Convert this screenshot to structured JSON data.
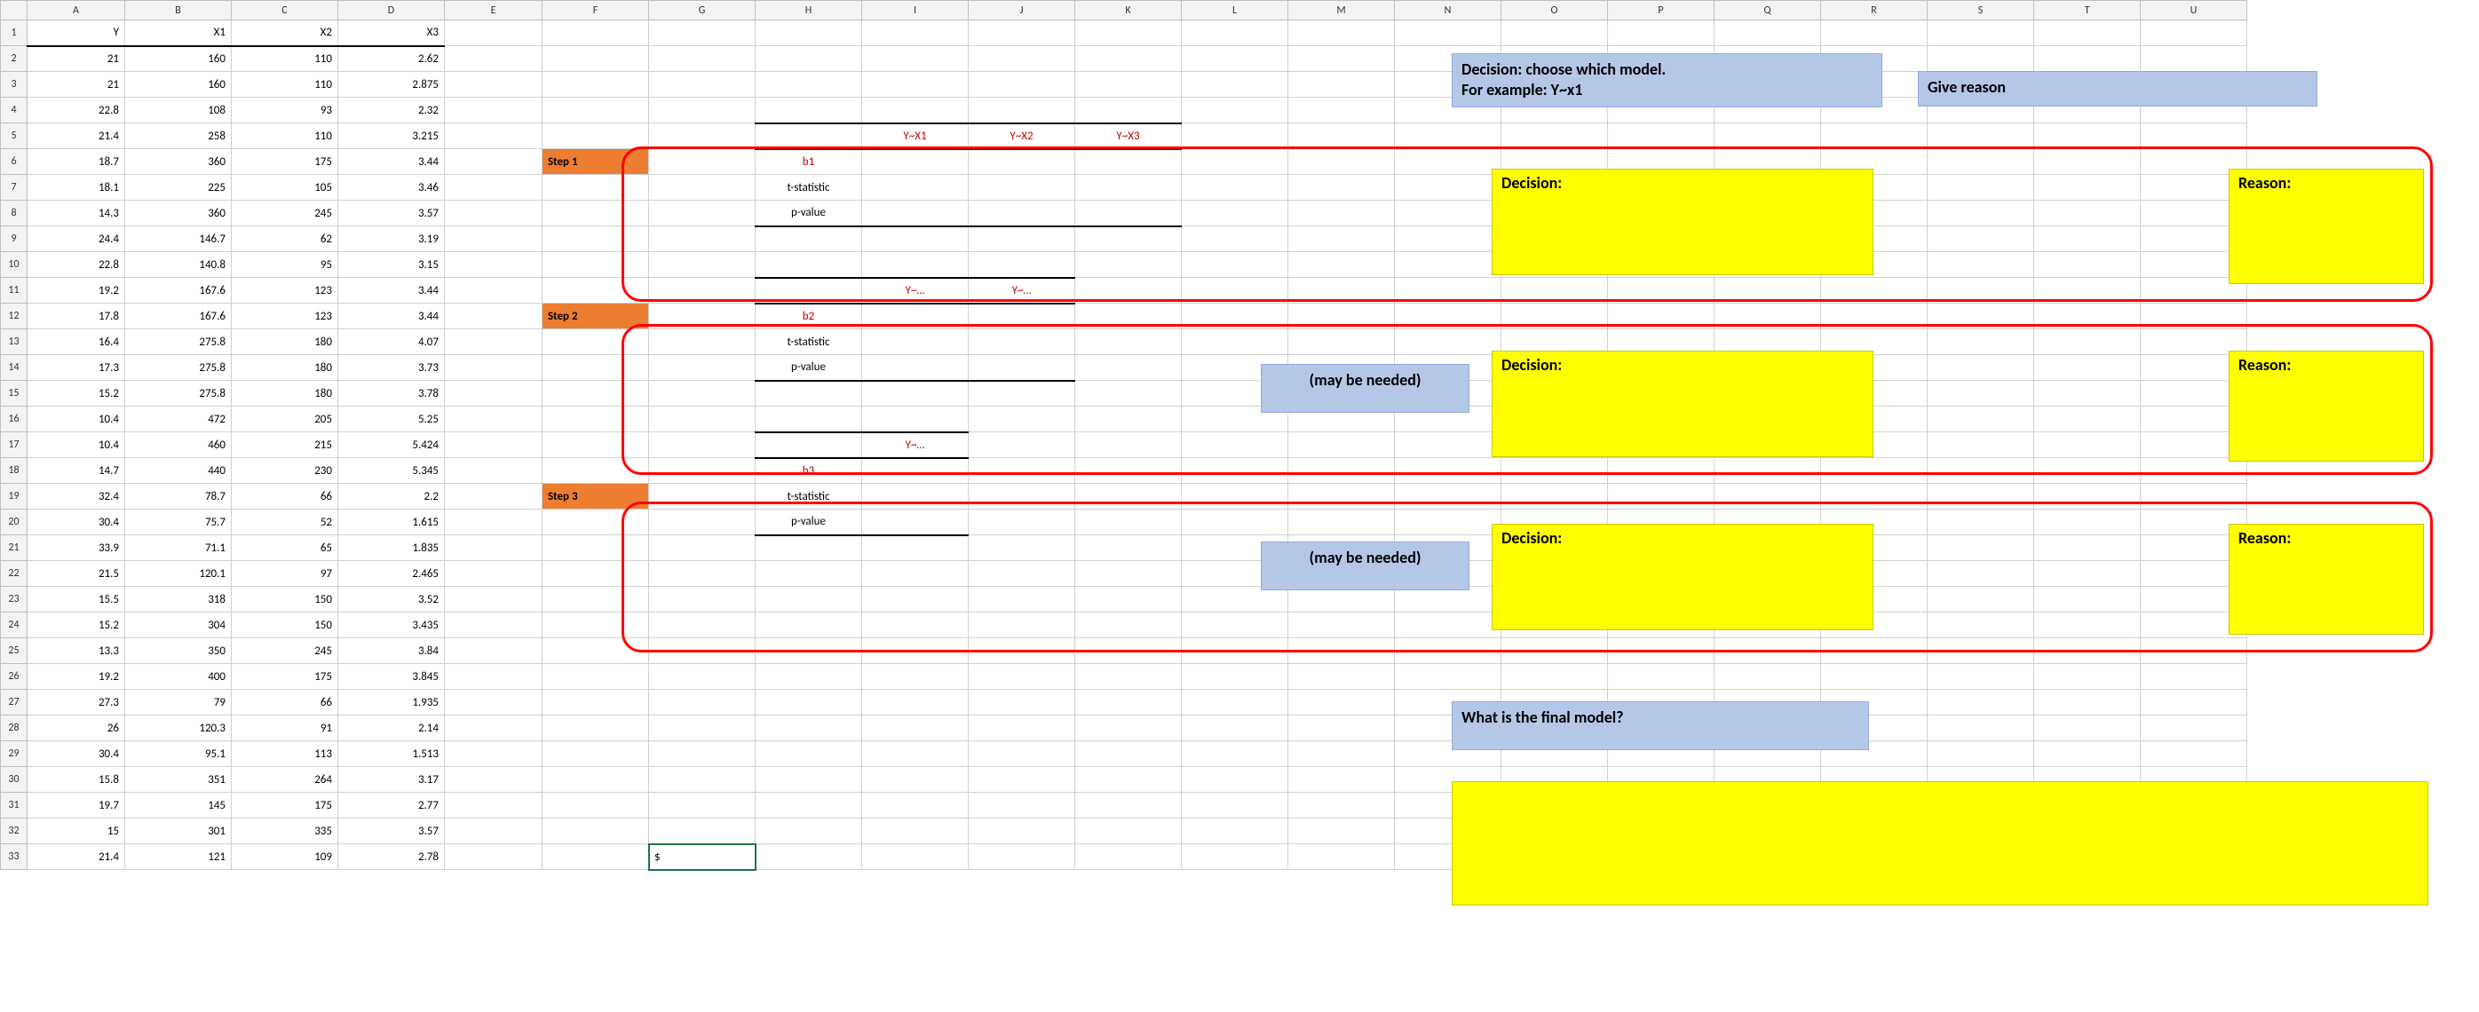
{
  "columns": [
    "A",
    "B",
    "C",
    "D",
    "E",
    "F",
    "G",
    "H",
    "I",
    "J",
    "K",
    "L",
    "M",
    "N",
    "O",
    "P",
    "Q",
    "R",
    "S",
    "T",
    "U"
  ],
  "headers": {
    "Y": "Y",
    "X1": "X1",
    "X2": "X2",
    "X3": "X3"
  },
  "rows": [
    {
      "Y": "21",
      "X1": "160",
      "X2": "110",
      "X3": "2.62"
    },
    {
      "Y": "21",
      "X1": "160",
      "X2": "110",
      "X3": "2.875"
    },
    {
      "Y": "22.8",
      "X1": "108",
      "X2": "93",
      "X3": "2.32"
    },
    {
      "Y": "21.4",
      "X1": "258",
      "X2": "110",
      "X3": "3.215"
    },
    {
      "Y": "18.7",
      "X1": "360",
      "X2": "175",
      "X3": "3.44"
    },
    {
      "Y": "18.1",
      "X1": "225",
      "X2": "105",
      "X3": "3.46"
    },
    {
      "Y": "14.3",
      "X1": "360",
      "X2": "245",
      "X3": "3.57"
    },
    {
      "Y": "24.4",
      "X1": "146.7",
      "X2": "62",
      "X3": "3.19"
    },
    {
      "Y": "22.8",
      "X1": "140.8",
      "X2": "95",
      "X3": "3.15"
    },
    {
      "Y": "19.2",
      "X1": "167.6",
      "X2": "123",
      "X3": "3.44"
    },
    {
      "Y": "17.8",
      "X1": "167.6",
      "X2": "123",
      "X3": "3.44"
    },
    {
      "Y": "16.4",
      "X1": "275.8",
      "X2": "180",
      "X3": "4.07"
    },
    {
      "Y": "17.3",
      "X1": "275.8",
      "X2": "180",
      "X3": "3.73"
    },
    {
      "Y": "15.2",
      "X1": "275.8",
      "X2": "180",
      "X3": "3.78"
    },
    {
      "Y": "10.4",
      "X1": "472",
      "X2": "205",
      "X3": "5.25"
    },
    {
      "Y": "10.4",
      "X1": "460",
      "X2": "215",
      "X3": "5.424"
    },
    {
      "Y": "14.7",
      "X1": "440",
      "X2": "230",
      "X3": "5.345"
    },
    {
      "Y": "32.4",
      "X1": "78.7",
      "X2": "66",
      "X3": "2.2"
    },
    {
      "Y": "30.4",
      "X1": "75.7",
      "X2": "52",
      "X3": "1.615"
    },
    {
      "Y": "33.9",
      "X1": "71.1",
      "X2": "65",
      "X3": "1.835"
    },
    {
      "Y": "21.5",
      "X1": "120.1",
      "X2": "97",
      "X3": "2.465"
    },
    {
      "Y": "15.5",
      "X1": "318",
      "X2": "150",
      "X3": "3.52"
    },
    {
      "Y": "15.2",
      "X1": "304",
      "X2": "150",
      "X3": "3.435"
    },
    {
      "Y": "13.3",
      "X1": "350",
      "X2": "245",
      "X3": "3.84"
    },
    {
      "Y": "19.2",
      "X1": "400",
      "X2": "175",
      "X3": "3.845"
    },
    {
      "Y": "27.3",
      "X1": "79",
      "X2": "66",
      "X3": "1.935"
    },
    {
      "Y": "26",
      "X1": "120.3",
      "X2": "91",
      "X3": "2.14"
    },
    {
      "Y": "30.4",
      "X1": "95.1",
      "X2": "113",
      "X3": "1.513"
    },
    {
      "Y": "15.8",
      "X1": "351",
      "X2": "264",
      "X3": "3.17"
    },
    {
      "Y": "19.7",
      "X1": "145",
      "X2": "175",
      "X3": "2.77"
    },
    {
      "Y": "15",
      "X1": "301",
      "X2": "335",
      "X3": "3.57"
    },
    {
      "Y": "21.4",
      "X1": "121",
      "X2": "109",
      "X3": "2.78"
    }
  ],
  "steps": {
    "step1": {
      "label": "Step 1",
      "models": {
        "m1": "Y~X1",
        "m2": "Y~X2",
        "m3": "Y~X3"
      },
      "rowlabels": {
        "b": "b1",
        "t": "t-statistic",
        "p": "p-value"
      }
    },
    "step2": {
      "label": "Step 2",
      "models": {
        "m1": "Y~…",
        "m2": "Y~…"
      },
      "rowlabels": {
        "b": "b2",
        "t": "t-statistic",
        "p": "p-value"
      },
      "maybe": "(may be needed)"
    },
    "step3": {
      "label": "Step 3",
      "models": {
        "m1": "Y~…"
      },
      "rowlabels": {
        "b": "b3",
        "t": "t-statistic",
        "p": "p-value"
      },
      "maybe": "(may be needed)"
    }
  },
  "boxes": {
    "decision_prompt": "Decision: choose which model.\nFor example: Y~x1",
    "give_reason": "Give reason",
    "decision": "Decision:",
    "reason": "Reason:",
    "final_q": "What is the final model?"
  },
  "editing": "$"
}
